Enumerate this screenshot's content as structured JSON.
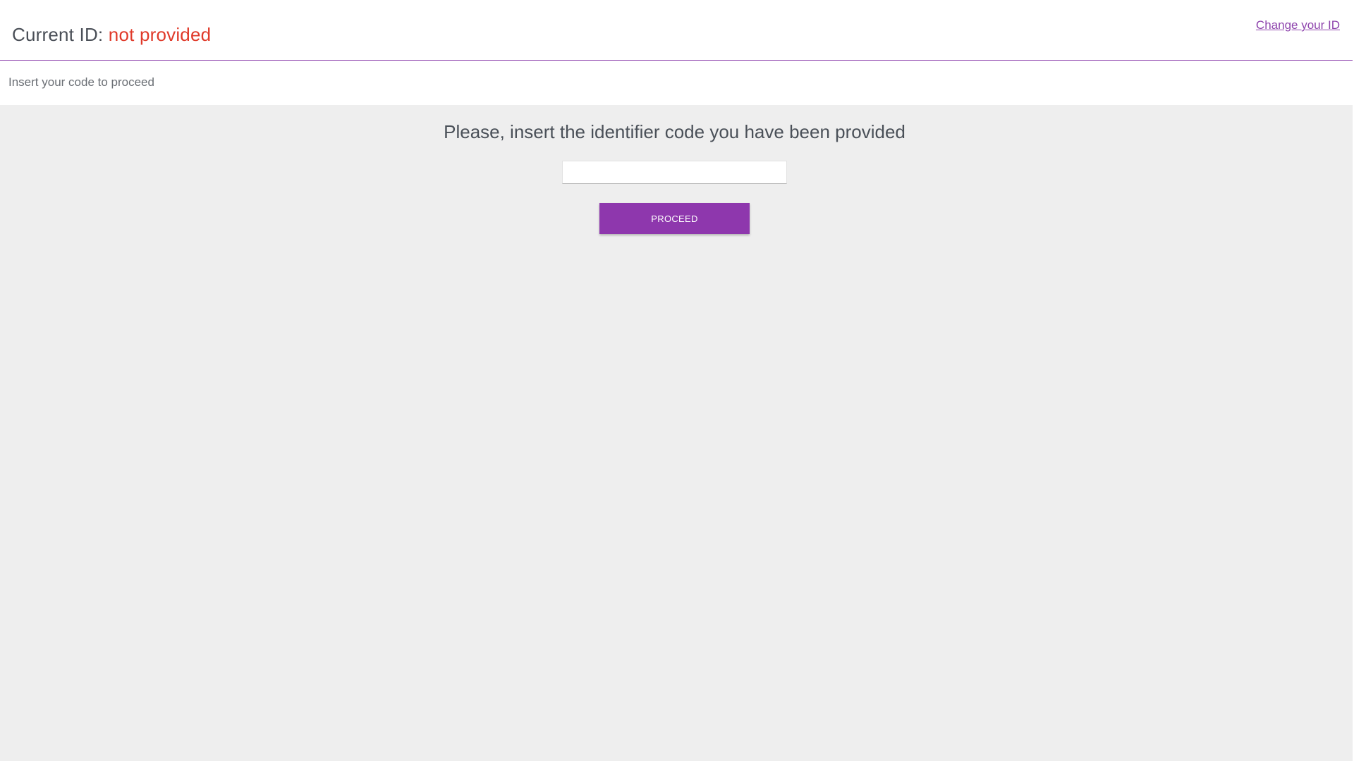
{
  "header": {
    "current_id_label": "Current ID: ",
    "current_id_value": "not provided",
    "change_id_link": "Change your ID"
  },
  "subheader": {
    "text": "Insert your code to proceed"
  },
  "main": {
    "title": "Please, insert the identifier code you have been provided",
    "code_input": {
      "value": "",
      "placeholder": ""
    },
    "proceed_button": "PROCEED"
  },
  "colors": {
    "accent": "#8e37ad",
    "error": "#e03a2a",
    "background": "#eeeeee"
  }
}
